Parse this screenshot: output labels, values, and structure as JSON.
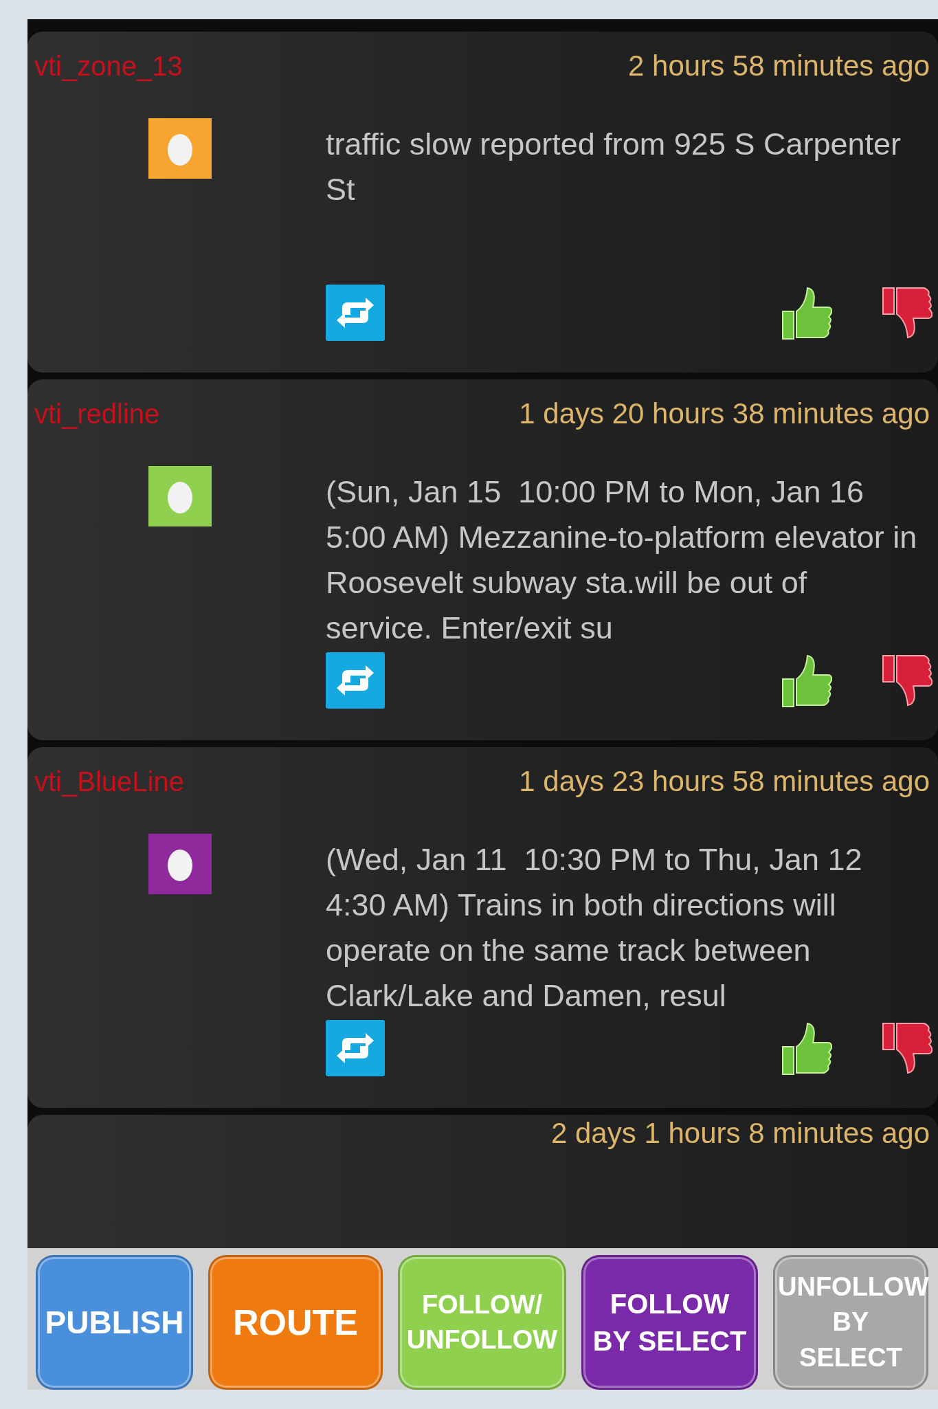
{
  "posts": [
    {
      "user": "vti_zone_13",
      "time": "2 hours 58 minutes ago",
      "color": "#f6a531",
      "message": "traffic slow reported from 925 S Carpenter St"
    },
    {
      "user": "vti_redline",
      "time": "1 days 20 hours 38 minutes ago",
      "color": "#8fd14f",
      "message": "(Sun, Jan 15  10:00 PM to Mon, Jan 16 5:00 AM) Mezzanine-to-platform elevator in Roosevelt subway sta.will be out of service. Enter/exit su"
    },
    {
      "user": "vti_BlueLine",
      "time": "1 days 23 hours 58 minutes ago",
      "color": "#8e2a9c",
      "message": "(Wed, Jan 11  10:30 PM to Thu, Jan 12 4:30 AM) Trains in both directions will operate on the same track between Clark/Lake and Damen, resul"
    }
  ],
  "partial_post": {
    "time": "2 days 1 hours 8 minutes ago"
  },
  "buttons": [
    {
      "label": "PUBLISH",
      "color": "#4a8fdc"
    },
    {
      "label": "ROUTE",
      "color": "#ef7a10"
    },
    {
      "label": "FOLLOW/\nUNFOLLOW",
      "color": "#8fd14f"
    },
    {
      "label": "FOLLOW\nBY SELECT",
      "color": "#7a2aa8"
    },
    {
      "label": "UNFOLLOW\nBY SELECT",
      "color": "#a8a8a8"
    }
  ]
}
